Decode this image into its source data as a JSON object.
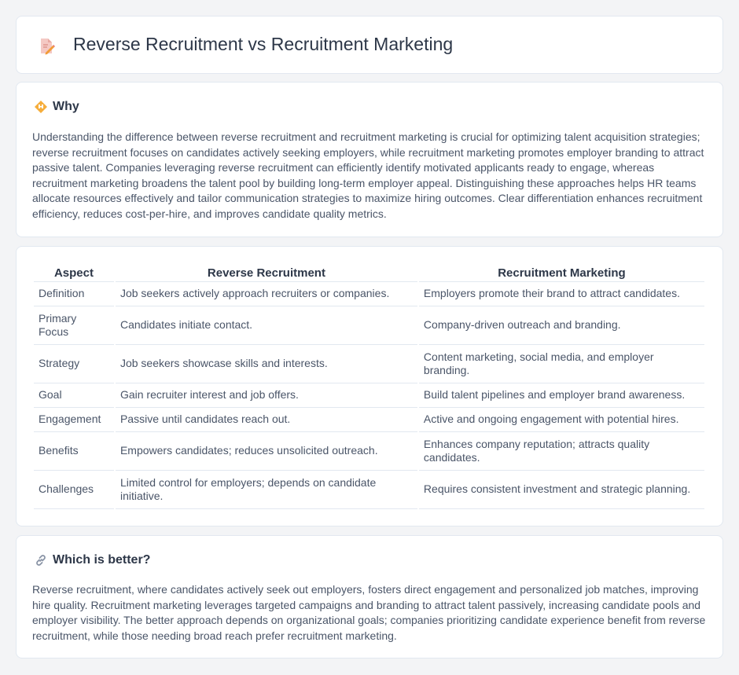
{
  "header": {
    "title": "Reverse Recruitment vs Recruitment Marketing",
    "icon": "document-pencil-icon"
  },
  "why": {
    "title": "Why",
    "icon": "diamond-warning-icon",
    "text": "Understanding the difference between reverse recruitment and recruitment marketing is crucial for optimizing talent acquisition strategies; reverse recruitment focuses on candidates actively seeking employers, while recruitment marketing promotes employer branding to attract passive talent. Companies leveraging reverse recruitment can efficiently identify motivated applicants ready to engage, whereas recruitment marketing broadens the talent pool by building long-term employer appeal. Distinguishing these approaches helps HR teams allocate resources effectively and tailor communication strategies to maximize hiring outcomes. Clear differentiation enhances recruitment efficiency, reduces cost-per-hire, and improves candidate quality metrics."
  },
  "table": {
    "headers": [
      "Aspect",
      "Reverse Recruitment",
      "Recruitment Marketing"
    ],
    "rows": [
      [
        "Definition",
        "Job seekers actively approach recruiters or companies.",
        "Employers promote their brand to attract candidates."
      ],
      [
        "Primary Focus",
        "Candidates initiate contact.",
        "Company-driven outreach and branding."
      ],
      [
        "Strategy",
        "Job seekers showcase skills and interests.",
        "Content marketing, social media, and employer branding."
      ],
      [
        "Goal",
        "Gain recruiter interest and job offers.",
        "Build talent pipelines and employer brand awareness."
      ],
      [
        "Engagement",
        "Passive until candidates reach out.",
        "Active and ongoing engagement with potential hires."
      ],
      [
        "Benefits",
        "Empowers candidates; reduces unsolicited outreach.",
        "Enhances company reputation; attracts quality candidates."
      ],
      [
        "Challenges",
        "Limited control for employers; depends on candidate initiative.",
        "Requires consistent investment and strategic planning."
      ]
    ]
  },
  "better": {
    "title": "Which is better?",
    "icon": "link-icon",
    "text": "Reverse recruitment, where candidates actively seek out employers, fosters direct engagement and personalized job matches, improving hire quality. Recruitment marketing leverages targeted campaigns and branding to attract talent passively, increasing candidate pools and employer visibility. The better approach depends on organizational goals; companies prioritizing candidate experience benefit from reverse recruitment, while those needing broad reach prefer recruitment marketing."
  },
  "colors": {
    "background": "#f3f4f6",
    "card": "#ffffff",
    "border": "#e2e8f0",
    "icon_orange": "#f59e0b",
    "icon_red": "#e57373"
  }
}
